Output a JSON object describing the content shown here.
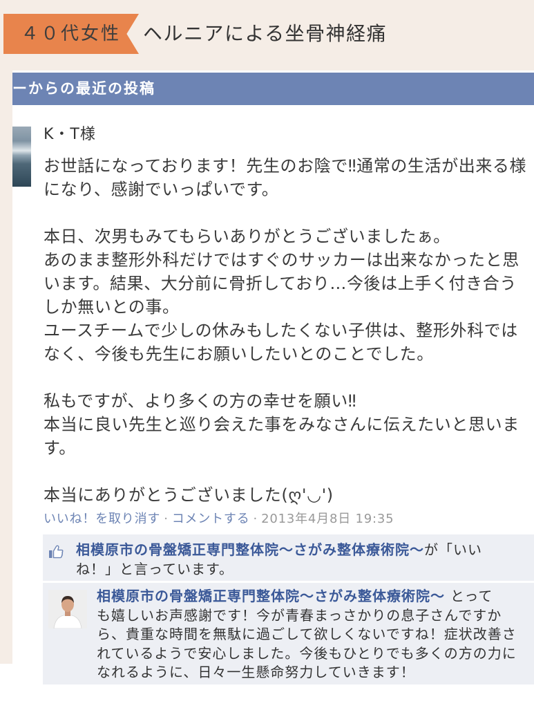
{
  "header": {
    "tag": "４０代女性",
    "title": "ヘルニアによる坐骨神経痛"
  },
  "feed": {
    "header_label": "ーからの最近の投稿"
  },
  "post": {
    "author": "K・T様",
    "paragraphs": [
      [
        "お世話になっております！先生のお陰で‼通常の生活が出来る様",
        "になり、感謝でいっぱいです。"
      ],
      [
        "本日、次男もみてもらいありがとうございましたぁ。",
        "あのまま整形外科だけではすぐのサッカーは出来なかったと思",
        "います。結果、大分前に骨折しており…今後は上手く付き合う",
        "しか無いとの事。",
        "ユースチームで少しの休みもしたくない子供は、整形外科では",
        "なく、今後も先生にお願いしたいとのことでした。"
      ],
      [
        "私もですが、より多くの方の幸せを願い‼",
        "本当に良い先生と巡り会えた事をみなさんに伝えたいと思いま",
        "す。"
      ],
      [
        "本当にありがとうございました(ღ'◡')"
      ]
    ],
    "actions": {
      "unlike": "いいね！を取り消す",
      "separator": "·",
      "comment": "コメントする",
      "timestamp": "2013年4月8日 19:35"
    },
    "likes": {
      "page_name": "相模原市の骨盤矯正専門整体院～さがみ整体療術院～",
      "first_line_suffix": "が「いい",
      "second_line": "ね！」と言っています。"
    },
    "comment": {
      "author": "相模原市の骨盤矯正専門整体院～さがみ整体療術院～",
      "first_line_suffix": "とって",
      "lines": [
        "も嬉しいお声感謝です！今が青春まっさかりの息子さんですか",
        "ら、貴重な時間を無駄に過ごして欲しくないですね！症状改善さ",
        "れているようで安心しました。今後もひとりでも多くの方の力に",
        "なれるように、日々一生懸命努力していきます！"
      ]
    }
  },
  "icons": {
    "like": "thumbs-up-icon",
    "post_avatar": "author-avatar",
    "comment_avatar": "commenter-avatar"
  },
  "colors": {
    "page_background": "#f5ede6",
    "tag_orange": "#e8844c",
    "header_blue": "#6d84b4",
    "link_blue": "#3b5998",
    "comment_background": "#edeff4"
  }
}
